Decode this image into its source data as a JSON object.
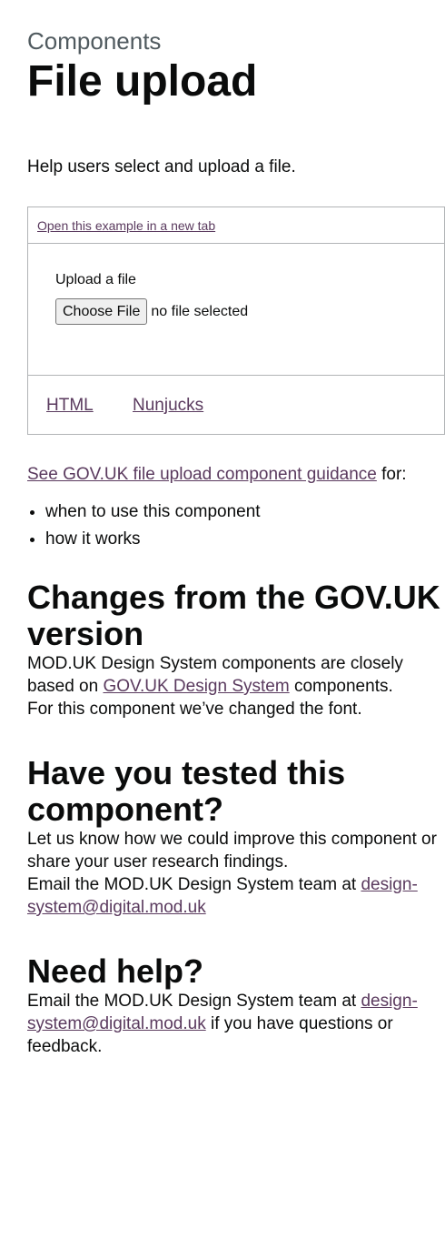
{
  "header": {
    "caption": "Components",
    "title": "File upload"
  },
  "lead": "Help users select and upload a file.",
  "example": {
    "open_link": "Open this example in a new tab",
    "upload_label": "Upload a file",
    "choose_button": "Choose File",
    "no_file_text": "no file selected",
    "tabs": [
      "HTML",
      "Nunjucks"
    ]
  },
  "guidance": {
    "link": "See GOV.UK file upload component guidance",
    "suffix": " for:",
    "bullets": [
      "when to use this component",
      "how it works"
    ]
  },
  "changes": {
    "heading": "Changes from the GOV.UK version",
    "p1_before": "MOD.UK Design System components are closely based on ",
    "p1_link": "GOV.UK Design System",
    "p1_after": " components.",
    "p2": "For this component we’ve changed the font."
  },
  "tested": {
    "heading": "Have you tested this component?",
    "p1": "Let us know how we could improve this component or share your user research findings.",
    "p2_before": "Email the MOD.UK Design System team at ",
    "p2_link": "design-system@digital.mod.uk"
  },
  "help": {
    "heading": "Need help?",
    "p_before": "Email the MOD.UK Design System team at ",
    "p_link": "design-system@digital.mod.uk",
    "p_after": " if you have questions or feedback."
  }
}
